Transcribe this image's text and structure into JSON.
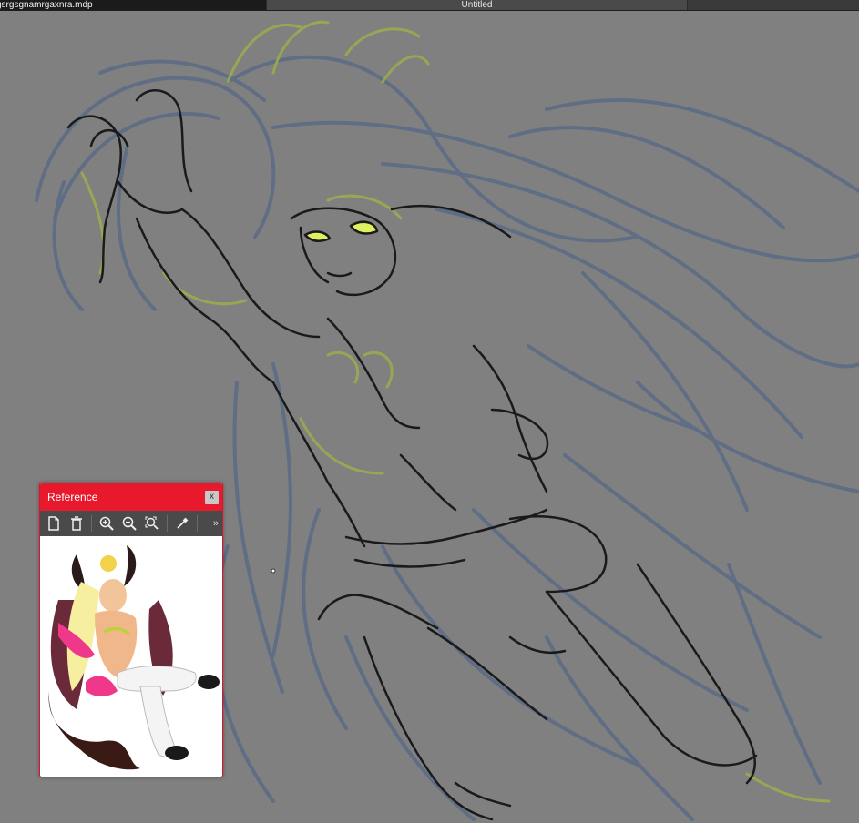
{
  "tabs": {
    "active_label": "gsrgsgnamrgaxnra.mdp",
    "untitled_label": "Untitled"
  },
  "colors": {
    "canvas_bg": "#808080",
    "sketch_blue": "#5a6b86",
    "sketch_green": "#9fb04a",
    "lineart": "#1a1a1a",
    "panel_accent": "#e8192c"
  },
  "reference_panel": {
    "title": "Reference",
    "close_label": "x",
    "more_label": "»",
    "toolbar_icons": [
      "new-page-icon",
      "trash-icon",
      "zoom-in-icon",
      "zoom-out-icon",
      "zoom-fit-icon",
      "eyedropper-icon"
    ]
  }
}
